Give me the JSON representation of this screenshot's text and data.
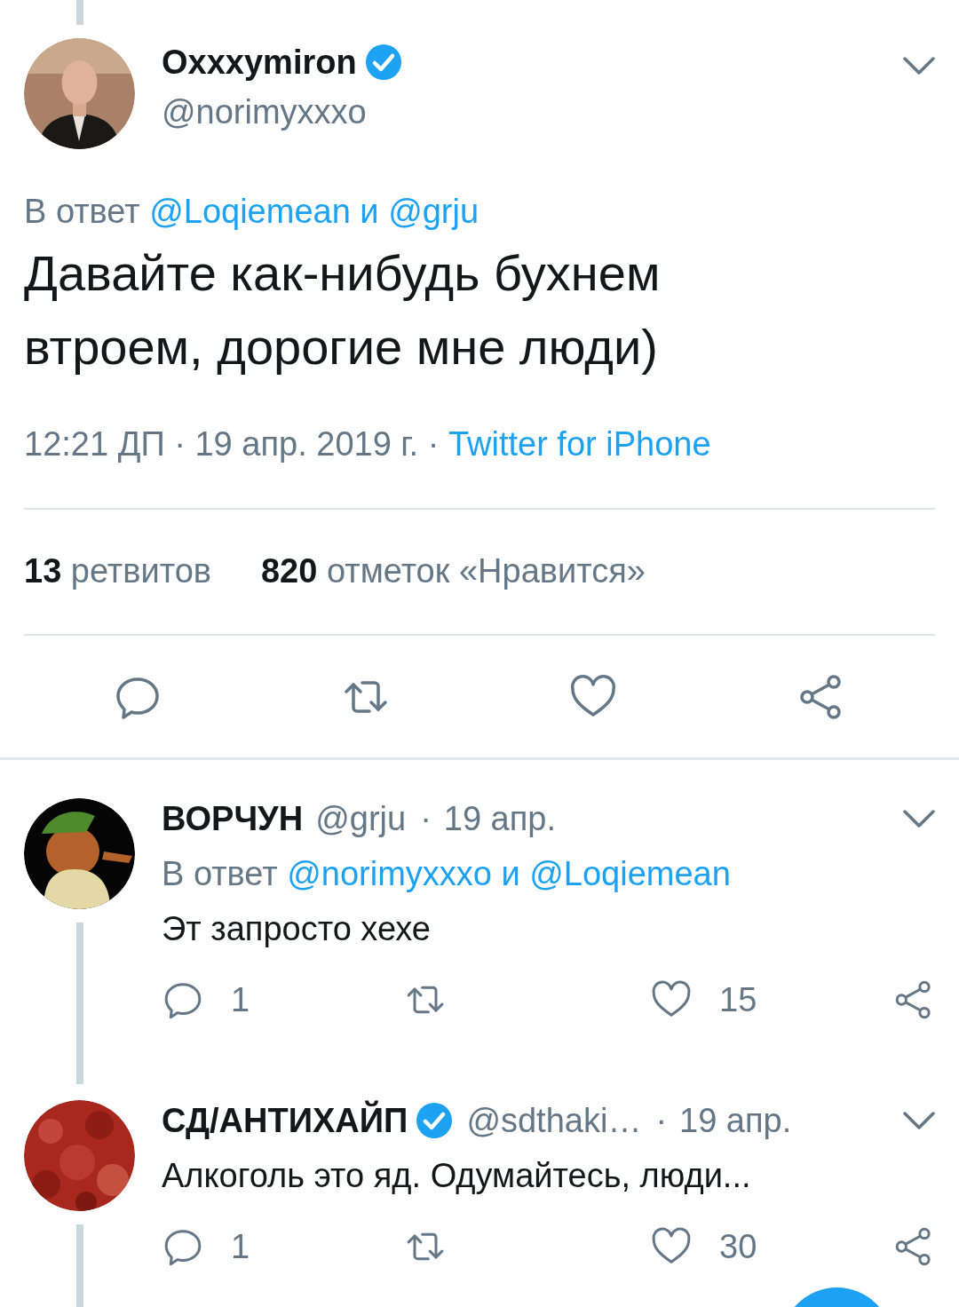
{
  "tweet": {
    "connected_above": true,
    "name": "Oxxxymiron",
    "verified": true,
    "handle": "@norimyxxxo",
    "reply_prefix": "В ответ",
    "reply_to": "@Loqiemean и @grju",
    "text": "Давайте как-нибудь бухнем втроем, дорогие мне люди)",
    "timestamp": "12:21 ДП · 19 апр. 2019 г.",
    "separator": "·",
    "source": "Twitter for iPhone",
    "stats": [
      "**13** ретвитов",
      "**820** отметок «Нравится»"
    ]
  },
  "replies": [
    {
      "name": "ВОРЧУН",
      "verified": false,
      "handle": "@grju",
      "separator": "·",
      "date": "19 апр.",
      "reply_prefix": "В ответ",
      "reply_to": "@norimyxxxo и @Loqiemean",
      "text": "Эт запросто хехе",
      "reply_count": "1",
      "like_count": "15",
      "connected_below": true
    },
    {
      "name": "СД/АНТИХАЙП",
      "verified": true,
      "handle": "@sdthaki…",
      "separator": "·",
      "date": "19 апр.",
      "text": "Алкоголь это яд. Одумайтесь, люди...",
      "reply_count": "1",
      "like_count": "30",
      "connected_below": true
    }
  ]
}
